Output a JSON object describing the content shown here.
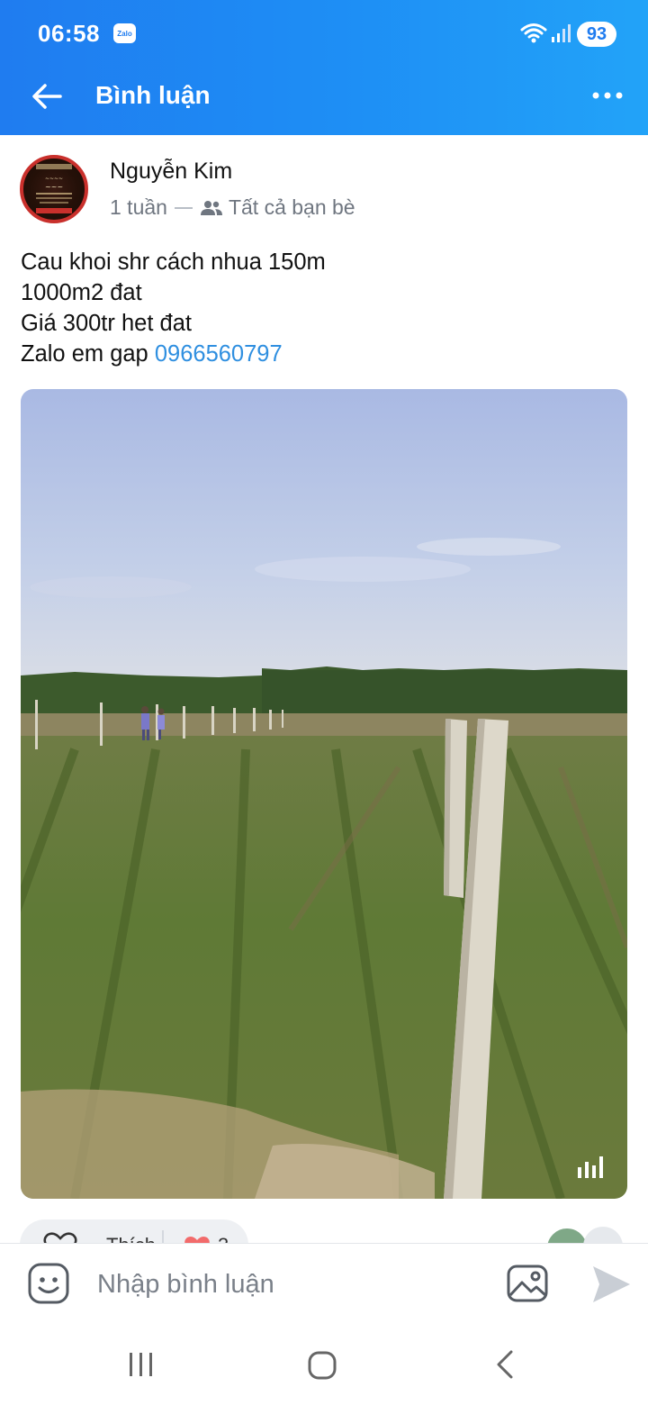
{
  "status_bar": {
    "time": "06:58",
    "app_badge": "Zalo",
    "battery": "93"
  },
  "header": {
    "title": "Bình luận",
    "icons": {
      "back": "arrow-left-icon",
      "more": "more-dots-icon"
    },
    "gradient": [
      "#1f7cf0",
      "#22a3f8"
    ]
  },
  "post": {
    "author": "Nguyễn Kim",
    "time_ago": "1 tuần",
    "audience": "Tất cả bạn bè",
    "audience_icon": "friends-icon",
    "text_lines": [
      "Cau khoi shr cách nhua 150m",
      "1000m2 đat",
      "Giá 300tr het đat"
    ],
    "contact_prefix": "Zalo em gap ",
    "contact_phone": "0966560797",
    "link_color": "#2f8fe0",
    "media": {
      "type": "video",
      "description_icon": "video-audio-icon"
    }
  },
  "reactions": {
    "like_label": "Thích",
    "reaction_count": "3"
  },
  "comment_bar": {
    "placeholder": "Nhập bình luận",
    "icons": {
      "emoji": "emoji-icon",
      "image": "image-icon",
      "send": "send-icon"
    }
  },
  "nav_bar": {
    "icons": [
      "recent-apps-icon",
      "home-icon",
      "back-icon"
    ]
  }
}
